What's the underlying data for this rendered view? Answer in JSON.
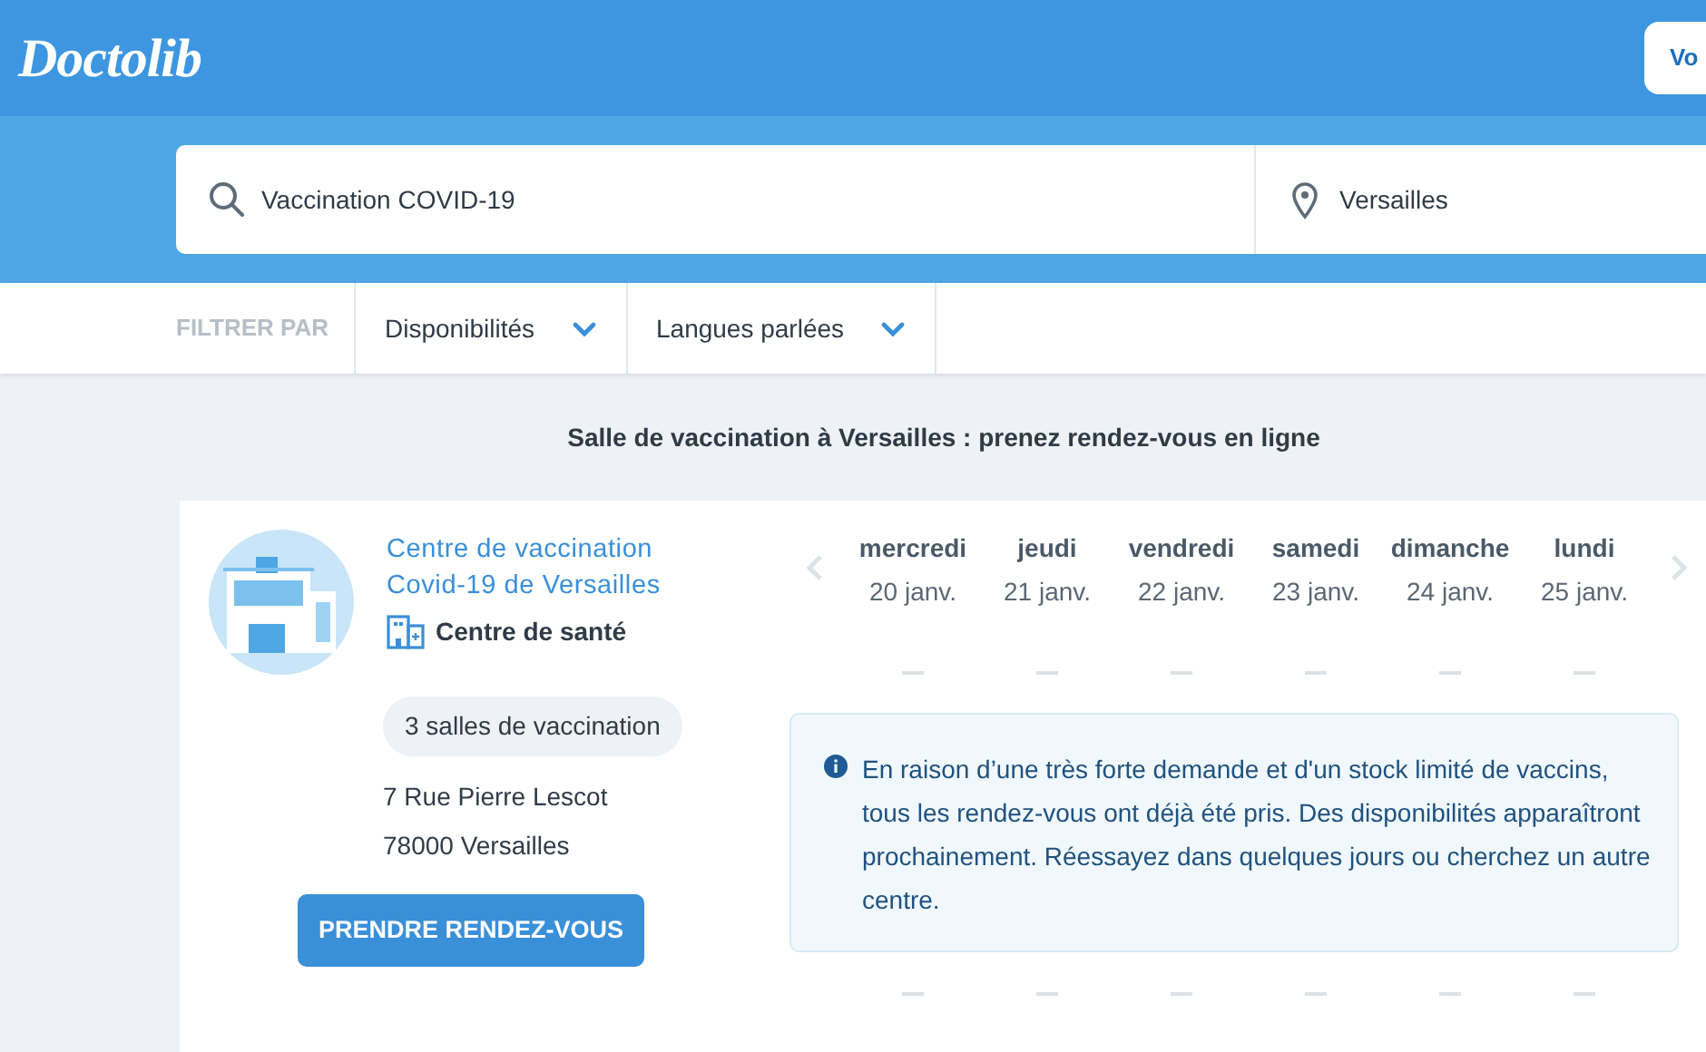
{
  "header": {
    "logo": "Doctolib",
    "button": "Vo"
  },
  "search": {
    "query": "Vaccination COVID-19",
    "location": "Versailles"
  },
  "filters": {
    "label": "FILTRER PAR",
    "items": [
      "Disponibilités",
      "Langues parlées"
    ]
  },
  "page_title": "Salle de vaccination à Versailles : prenez rendez-vous en ligne",
  "result": {
    "name_lines": [
      "Centre de vaccination",
      "Covid-19 de Versailles"
    ],
    "type": "Centre de santé",
    "rooms": "3 salles de vaccination",
    "address": [
      "7 Rue Pierre Lescot",
      "78000 Versailles"
    ],
    "button": "PRENDRE RENDEZ-VOUS",
    "days": [
      {
        "day": "mercredi",
        "date": "20 janv."
      },
      {
        "day": "jeudi",
        "date": "21 janv."
      },
      {
        "day": "vendredi",
        "date": "22 janv."
      },
      {
        "day": "samedi",
        "date": "23 janv."
      },
      {
        "day": "dimanche",
        "date": "24 janv."
      },
      {
        "day": "lundi",
        "date": "25 janv."
      }
    ],
    "notice": "En raison d’une très forte demande et d'un stock limité de vaccins, tous les rendez-vous ont déjà été pris. Des disponibilités apparaîtront prochainement. Réessayez dans quelques jours ou cherchez un autre centre."
  }
}
